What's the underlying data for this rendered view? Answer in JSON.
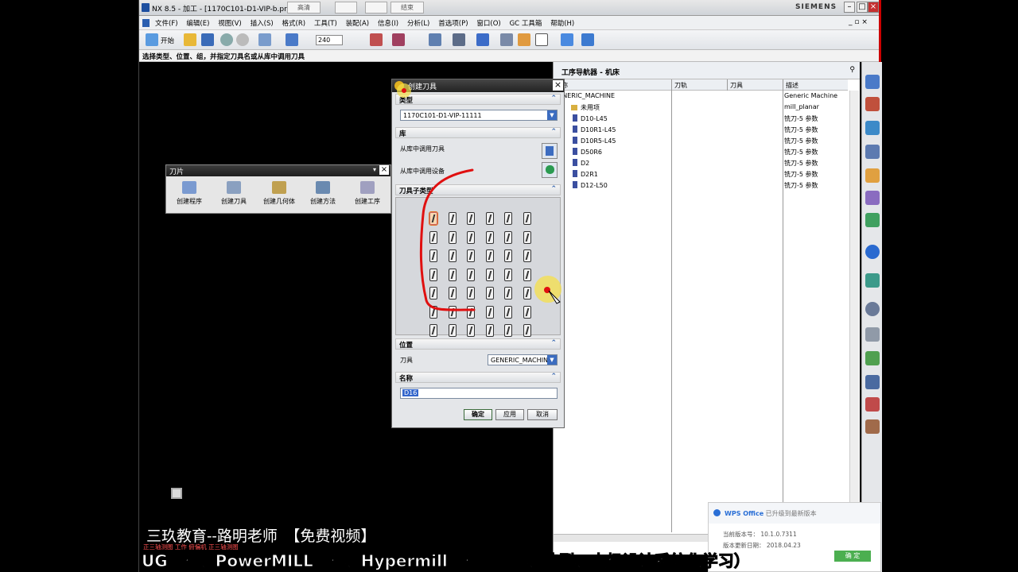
{
  "titlebar": {
    "title": "NX 8.5 - 加工 - [1170C101-D1-VIP-b.prt",
    "brand": "SIEMENS",
    "qa_buttons": [
      "高清",
      "",
      "",
      "结束"
    ]
  },
  "menubar": {
    "items": [
      "文件(F)",
      "编辑(E)",
      "视图(V)",
      "插入(S)",
      "格式(R)",
      "工具(T)",
      "装配(A)",
      "信息(I)",
      "分析(L)",
      "首选项(P)",
      "窗口(O)",
      "GC 工具箱",
      "帮助(H)"
    ]
  },
  "toolbar": {
    "start_label": "开始",
    "zoom_value": "240"
  },
  "cue_line": "选择类型、位置、组，并指定刀具名或从库中调用刀具",
  "tool_panel": {
    "title": "刀片",
    "items": [
      "创建程序",
      "创建刀具",
      "创建几何体",
      "创建方法",
      "创建工序"
    ]
  },
  "dialog": {
    "title": "创建刀具",
    "type_section": "类型",
    "type_value": "1170C101-D1-VIP-11111",
    "library_section": "库",
    "lib_tool_label": "从库中调用刀具",
    "lib_device_label": "从库中调用设备",
    "subtype_section": "刀具子类型",
    "location_section": "位置",
    "location_tool_label": "刀具",
    "location_tool_value": "GENERIC_MACHIN",
    "name_section": "名称",
    "name_value": "D16",
    "ok_label": "确定",
    "apply_label": "应用",
    "cancel_label": "取消"
  },
  "navigator": {
    "title": "工序导航器 - 机床",
    "columns": [
      "名称",
      "刀轨",
      "刀具",
      "描述"
    ],
    "rows": [
      {
        "name": "GENERIC_MACHINE",
        "desc": "Generic Machine"
      },
      {
        "name": "未用项",
        "desc": "mill_planar"
      },
      {
        "name": "D10-L45",
        "desc": "铣刀-5 参数"
      },
      {
        "name": "D10R1-L45",
        "desc": "铣刀-5 参数"
      },
      {
        "name": "D10R5-L45",
        "desc": "铣刀-5 参数"
      },
      {
        "name": "D50R6",
        "desc": "铣刀-5 参数"
      },
      {
        "name": "D2",
        "desc": "铣刀-5 参数"
      },
      {
        "name": "D2R1",
        "desc": "铣刀-5 参数"
      },
      {
        "name": "D12-L50",
        "desc": "铣刀-5 参数"
      }
    ]
  },
  "wps": {
    "header_brand": "WPS Office",
    "header_text": "已升级到最新版本",
    "version_line": "当前版本号： 10.1.0.7311",
    "date_line": "版本更新日期： 2018.04.23",
    "ok_label": "确 定"
  },
  "captions": {
    "line1": "三玖教育--路明老师　【免费视频】",
    "line2": "正三轴测图 工作 俯偏机 正三轴测图",
    "line3": "UG编程、PowerMILL编程、Hypermill编程（画图、造型、电极设计系统化学习）"
  },
  "colors": {
    "accent": "#2a5caa",
    "annotation": "#e01010",
    "cursor_highlight": "#f5e04a"
  }
}
